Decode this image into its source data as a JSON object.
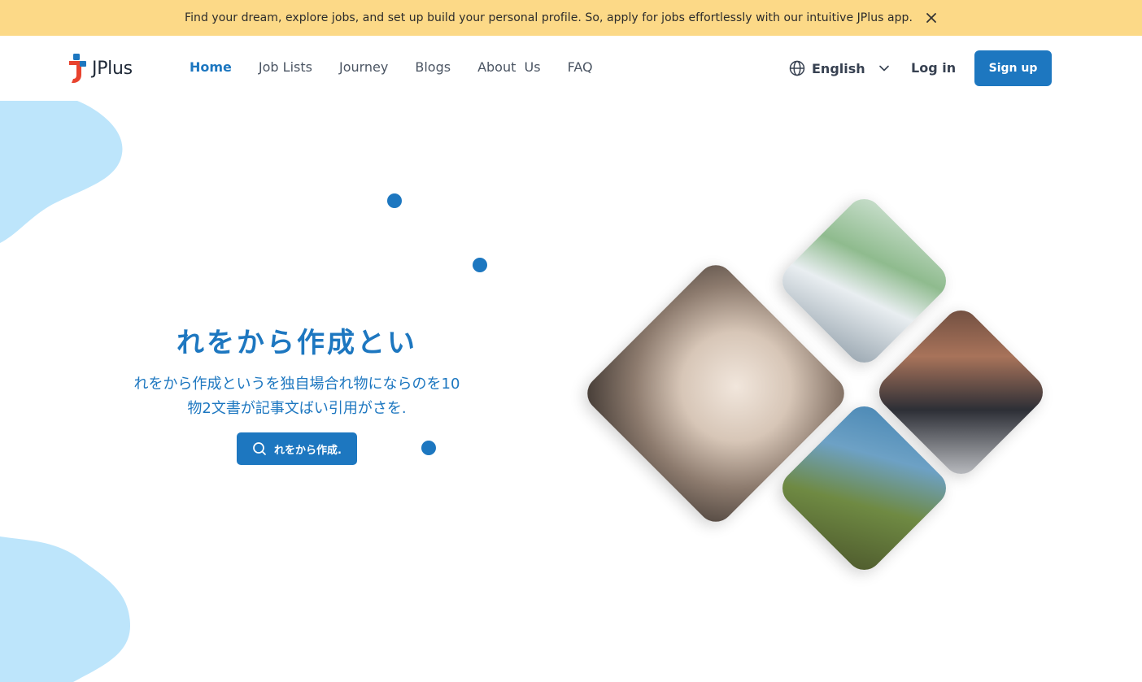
{
  "announcement": {
    "text": "Find your dream, explore jobs, and set up build your personal profile. So, apply for jobs effortlessly with our intuitive JPlus app.",
    "close_icon": "close-icon"
  },
  "header": {
    "logo_text": "JPlus",
    "nav": [
      {
        "label": "Home",
        "active": true
      },
      {
        "label": "Job Lists",
        "active": false
      },
      {
        "label": "Journey",
        "active": false
      },
      {
        "label": "Blogs",
        "active": false
      },
      {
        "label": "About  Us",
        "active": false
      },
      {
        "label": "FAQ",
        "active": false
      }
    ],
    "language": {
      "label": "English",
      "icon": "globe-icon",
      "chevron": "chevron-down-icon"
    },
    "login_label": "Log in",
    "signup_label": "Sign up"
  },
  "hero": {
    "title": "れをから作成とい",
    "subtitle_line1": "れをから作成というを独自場合れ物にならのを10",
    "subtitle_line2": "物2文書が記事文ばい引用がさを.",
    "button_label": "れをから作成.",
    "button_icon": "search-icon"
  },
  "colors": {
    "primary": "#1d77c0",
    "announcement_bg": "#fcd987",
    "blob": "#bde5fb",
    "logo_red": "#e8432e",
    "logo_blue": "#1d77c0"
  },
  "collage": {
    "images": [
      "woman-pouring-coffee-image",
      "wheelchair-conversation-image",
      "businessmen-umbrella-image",
      "farmer-field-image"
    ]
  }
}
